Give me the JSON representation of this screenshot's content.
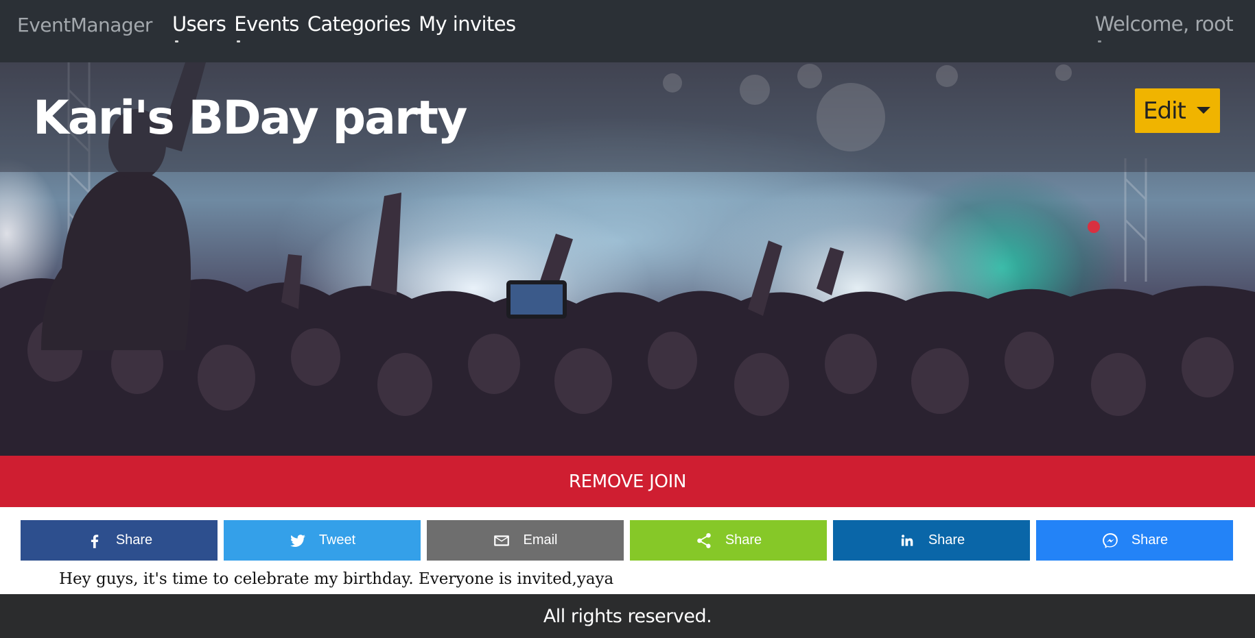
{
  "navbar": {
    "brand": "EventManager",
    "items": [
      {
        "label": "Users"
      },
      {
        "label": "Events"
      },
      {
        "label": "Categories"
      },
      {
        "label": "My invites"
      }
    ],
    "welcome": "Welcome, root"
  },
  "event": {
    "title": "Kari's BDay party",
    "edit_label": "Edit",
    "remove_join_label": "REMOVE JOIN",
    "description": "Hey guys, it's time to celebrate my birthday. Everyone is invited,yaya"
  },
  "share_buttons": [
    {
      "label": "Share",
      "icon": "facebook-icon",
      "color": "#2d4f8e"
    },
    {
      "label": "Tweet",
      "icon": "twitter-icon",
      "color": "#34a0e9"
    },
    {
      "label": "Email",
      "icon": "email-icon",
      "color": "#6e6e6e"
    },
    {
      "label": "Share",
      "icon": "share-icon",
      "color": "#86c828"
    },
    {
      "label": "Share",
      "icon": "linkedin-icon",
      "color": "#0a66a8"
    },
    {
      "label": "Share",
      "icon": "messenger-icon",
      "color": "#2383f7"
    }
  ],
  "footer": {
    "text": "All rights reserved."
  },
  "colors": {
    "navbar_bg": "#2b3036",
    "edit_button": "#f0b400",
    "remove_join": "#cf1e31",
    "footer_bg": "#2b2c2d"
  }
}
